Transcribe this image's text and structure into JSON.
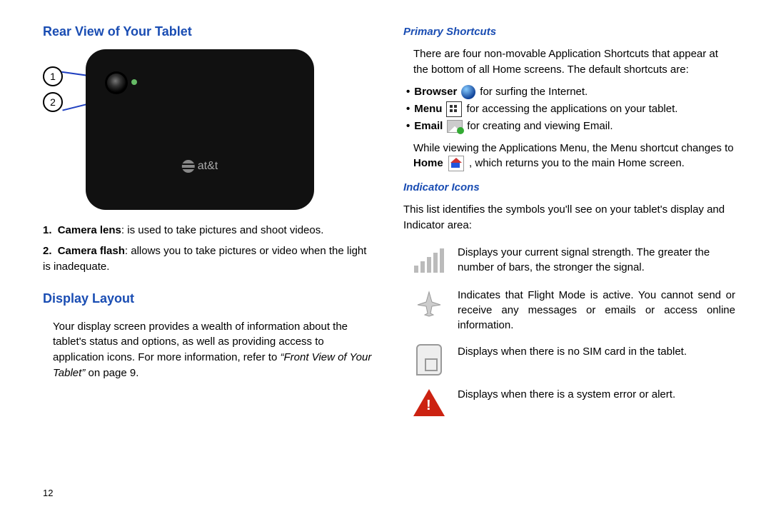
{
  "page_number": "12",
  "left": {
    "h_rear": "Rear View of Your Tablet",
    "callouts": {
      "n1": "1",
      "n2": "2"
    },
    "att_label": "at&t",
    "list": [
      {
        "n": "1.",
        "bold": "Camera lens",
        "rest": ": is used to take pictures and shoot videos."
      },
      {
        "n": "2.",
        "bold": "Camera flash",
        "rest": ": allows you to take pictures or video when the light is inadequate."
      }
    ],
    "h_display": "Display Layout",
    "display_para_a": "Your display screen provides a wealth of information about the tablet's status and options, as well as providing access to application icons. For more information, refer to ",
    "display_para_xref": "“Front View of Your Tablet”",
    "display_para_b": "  on page 9."
  },
  "right": {
    "h_shortcuts": "Primary Shortcuts",
    "shortcuts_intro": "There are four non-movable Application Shortcuts that appear at the bottom of all Home screens. The default shortcuts are:",
    "bullets": [
      {
        "bold": "Browser",
        "tail": " for surfing the Internet."
      },
      {
        "bold": "Menu",
        "tail": " for accessing the applications on your tablet."
      },
      {
        "bold": "Email",
        "tail": " for creating and viewing Email."
      }
    ],
    "home_para_a": "While viewing the Applications Menu, the Menu shortcut changes to ",
    "home_bold": "Home",
    "home_para_b": ", which returns you to the main Home screen.",
    "h_indicators": "Indicator Icons",
    "indicators_intro": "This list identifies the symbols you'll see on your tablet's display and Indicator area:",
    "ind": [
      "Displays your current signal strength. The greater the number of bars, the stronger the signal.",
      "Indicates that Flight Mode is active. You cannot send or receive any messages or emails or access online information.",
      "Displays when there is no SIM card in the tablet.",
      "Displays when there is a system error or alert."
    ]
  }
}
